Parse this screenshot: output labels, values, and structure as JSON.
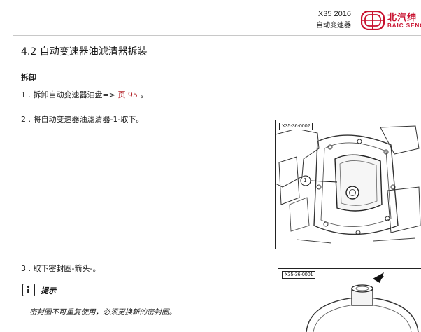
{
  "header": {
    "model": "X35 2016",
    "section": "自动变速器",
    "logo_cn": "北汽绅",
    "logo_en": "BAIC SENO"
  },
  "section_title": "4.2 自动变速器油滤清器拆装",
  "subheading": "拆卸",
  "steps": [
    {
      "num": "1 .",
      "text": "拆卸自动变速器油盘=>",
      "ref": "页 95",
      "after": "。"
    },
    {
      "num": "2 .",
      "text": "将自动变速器油滤清器-1-取下。"
    },
    {
      "num": "3 .",
      "text": "取下密封圈-箭头-。"
    }
  ],
  "figures": [
    {
      "label": "X35-36-0002",
      "callout": "1"
    },
    {
      "label": "X35-36-0001"
    }
  ],
  "tip": {
    "label": "提示",
    "text": "密封圈不可重复使用，必须更换新的密封圈。"
  },
  "colors": {
    "accent": "#c8102e",
    "ref_link": "#b3242a"
  }
}
